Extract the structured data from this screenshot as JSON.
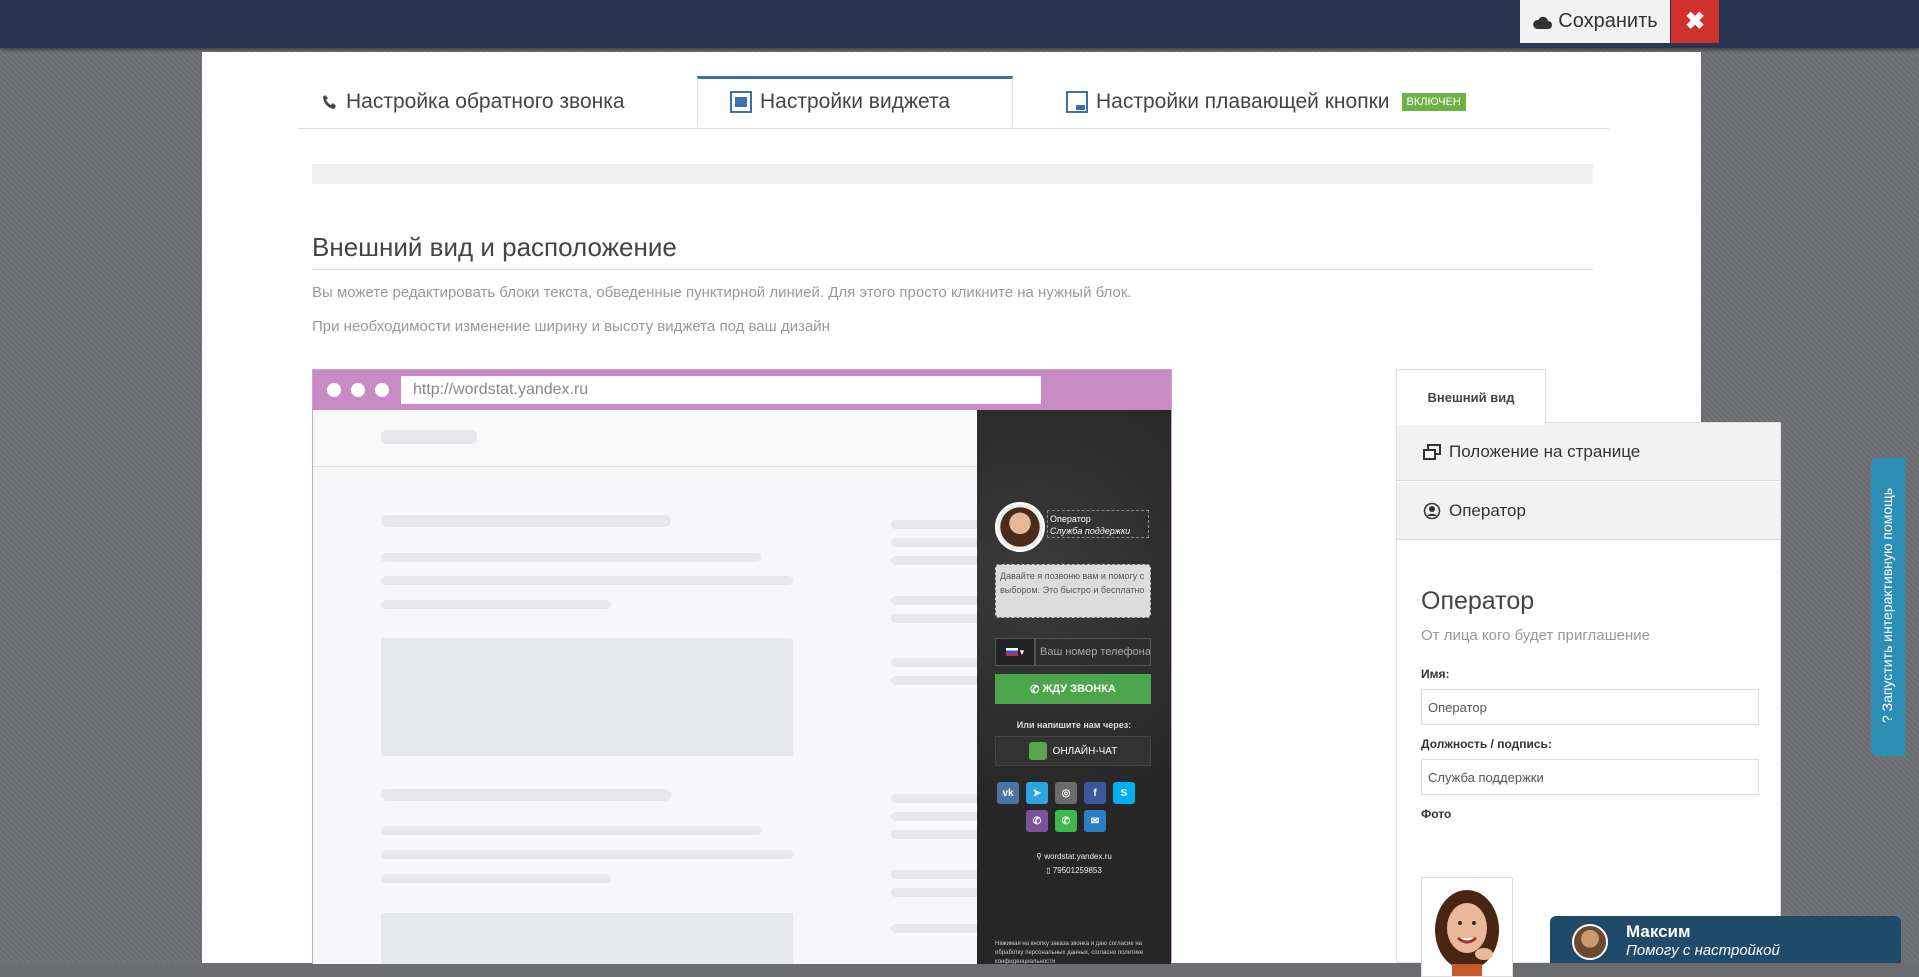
{
  "toolbar": {
    "save_label": "Сохранить",
    "close_label": "✖"
  },
  "tabs": [
    {
      "label": "Настройка обратного звонка",
      "icon": "phone-icon"
    },
    {
      "label": "Настройки виджета",
      "icon": "widget-icon"
    },
    {
      "label": "Настройки плавающей кнопки",
      "icon": "floating-button-icon",
      "badge": "ВКЛЮЧЕН"
    }
  ],
  "section": {
    "title": "Внешний вид и расположение",
    "help1": "Вы можете редактировать блоки текста, обведенные пунктирной линией. Для этого просто кликните на нужный блок.",
    "help2": "При необходимости изменение ширину и высоту виджета под ваш дизайн"
  },
  "preview": {
    "url": "http://wordstat.yandex.ru",
    "widget": {
      "operator_name": "Оператор",
      "operator_role": "Служба поддержки",
      "bubble_text": "Давайте я позвоню вам и помогу с выбором. Это быстро и бесплатно",
      "phone_placeholder": "Ваш номер телефона",
      "call_button": "ЖДУ ЗВОНКА",
      "or_text": "Или напишите нам через:",
      "chat_button": "ОНЛАЙН-ЧАТ",
      "site": "wordstat.yandex.ru",
      "phone": "79501259853",
      "legal": "Нажимая на кнопку заказа звонка я даю согласие на обработку персональных данных, согласно политике конфиденциальности"
    }
  },
  "side": {
    "tab_label": "Внешний вид",
    "accordion": [
      {
        "label": "Положение на странице",
        "icon": "window-restore-icon"
      },
      {
        "label": "Оператор",
        "icon": "user-circle-icon"
      }
    ],
    "form": {
      "title": "Оператор",
      "subtitle": "От лица кого будет приглашение",
      "name_label": "Имя:",
      "name_value": "Оператор",
      "role_label": "Должность / подпись:",
      "role_value": "Служба поддержки",
      "photo_label": "Фото"
    }
  },
  "help_tab": "? Запустить интерактивную помощь",
  "chat": {
    "name": "Максим",
    "subtitle": "Помогу с настройкой"
  }
}
